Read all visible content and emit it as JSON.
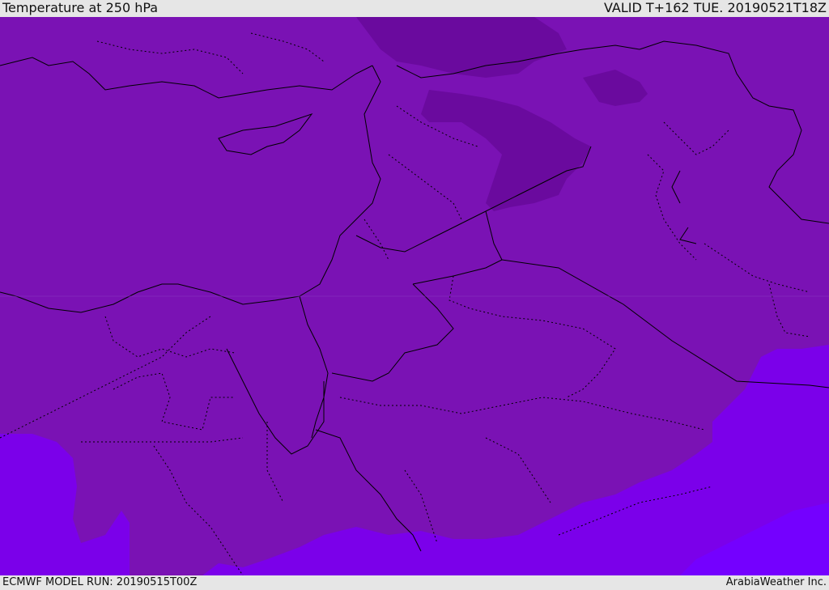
{
  "header": {
    "title": "Temperature at 250 hPa",
    "valid": "VALID T+162 TUE. 20190521T18Z"
  },
  "footer": {
    "model_run": "ECMWF MODEL RUN: 20190515T00Z",
    "credit": "ArabiaWeather Inc."
  },
  "colors": {
    "warm_band": "#7a12b4",
    "cool_pocket": "#6a0a9e",
    "cold_region": "#7b00ea",
    "coldest_region": "#7400ff",
    "coastline": "#000000",
    "border": "#000000"
  }
}
